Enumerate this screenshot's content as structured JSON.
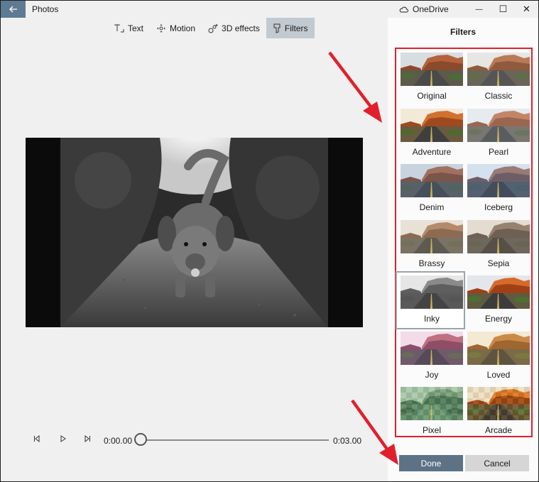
{
  "window": {
    "app_title": "Photos",
    "cloud_label": "OneDrive",
    "back_icon": "back-arrow-icon",
    "minimize_glyph": "—",
    "maximize_glyph": "☐",
    "close_glyph": "✕"
  },
  "toolbar": {
    "items": [
      {
        "label": "Text",
        "icon": "text-icon",
        "active": false
      },
      {
        "label": "Motion",
        "icon": "motion-icon",
        "active": false
      },
      {
        "label": "3D effects",
        "icon": "3d-effects-icon",
        "active": false
      },
      {
        "label": "Filters",
        "icon": "filters-icon",
        "active": true
      }
    ]
  },
  "playback": {
    "current_time": "0:00.00",
    "end_time": "0:03.00",
    "progress": 0
  },
  "panel": {
    "title": "Filters",
    "filters": [
      {
        "label": "Original",
        "tone": "original",
        "selected": false
      },
      {
        "label": "Classic",
        "tone": "classic",
        "selected": false
      },
      {
        "label": "Adventure",
        "tone": "adventure",
        "selected": false
      },
      {
        "label": "Pearl",
        "tone": "pearl",
        "selected": false
      },
      {
        "label": "Denim",
        "tone": "denim",
        "selected": false
      },
      {
        "label": "Iceberg",
        "tone": "iceberg",
        "selected": false
      },
      {
        "label": "Brassy",
        "tone": "brassy",
        "selected": false
      },
      {
        "label": "Sepia",
        "tone": "sepia",
        "selected": false
      },
      {
        "label": "Inky",
        "tone": "inky",
        "selected": true
      },
      {
        "label": "Energy",
        "tone": "energy",
        "selected": false
      },
      {
        "label": "Joy",
        "tone": "joy",
        "selected": false
      },
      {
        "label": "Loved",
        "tone": "loved",
        "selected": false
      },
      {
        "label": "Pixel",
        "tone": "pixel",
        "selected": false
      },
      {
        "label": "Arcade",
        "tone": "arcade",
        "selected": false
      }
    ],
    "done_label": "Done",
    "cancel_label": "Cancel"
  },
  "colors": {
    "accent": "#5d7285",
    "highlight_box": "#e0202b",
    "toolbar_active": "#c2cad1"
  }
}
